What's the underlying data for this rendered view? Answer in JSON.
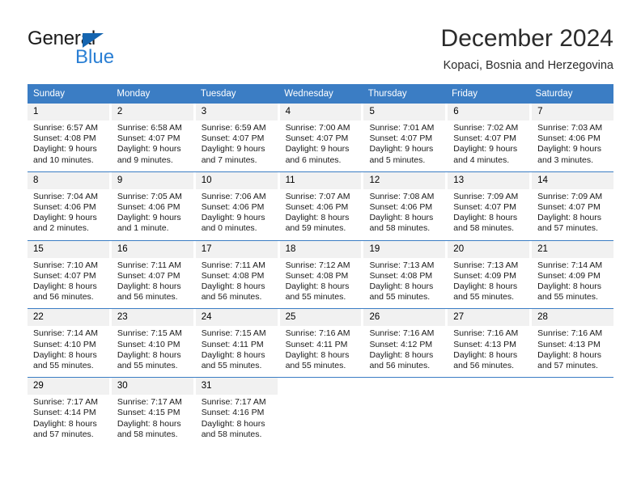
{
  "logo": {
    "word_top": "General",
    "word_bottom": "Blue",
    "triangle_color": "#1565b0",
    "blue_color": "#2a7fd4"
  },
  "header": {
    "title": "December 2024",
    "subtitle": "Kopaci, Bosnia and Herzegovina"
  },
  "calendar": {
    "header_bg": "#3b7dc4",
    "daynum_bg": "#f1f1f1",
    "weekdays": [
      "Sunday",
      "Monday",
      "Tuesday",
      "Wednesday",
      "Thursday",
      "Friday",
      "Saturday"
    ],
    "weeks": [
      [
        {
          "day": "1",
          "sunrise": "Sunrise: 6:57 AM",
          "sunset": "Sunset: 4:08 PM",
          "daylight1": "Daylight: 9 hours",
          "daylight2": "and 10 minutes."
        },
        {
          "day": "2",
          "sunrise": "Sunrise: 6:58 AM",
          "sunset": "Sunset: 4:07 PM",
          "daylight1": "Daylight: 9 hours",
          "daylight2": "and 9 minutes."
        },
        {
          "day": "3",
          "sunrise": "Sunrise: 6:59 AM",
          "sunset": "Sunset: 4:07 PM",
          "daylight1": "Daylight: 9 hours",
          "daylight2": "and 7 minutes."
        },
        {
          "day": "4",
          "sunrise": "Sunrise: 7:00 AM",
          "sunset": "Sunset: 4:07 PM",
          "daylight1": "Daylight: 9 hours",
          "daylight2": "and 6 minutes."
        },
        {
          "day": "5",
          "sunrise": "Sunrise: 7:01 AM",
          "sunset": "Sunset: 4:07 PM",
          "daylight1": "Daylight: 9 hours",
          "daylight2": "and 5 minutes."
        },
        {
          "day": "6",
          "sunrise": "Sunrise: 7:02 AM",
          "sunset": "Sunset: 4:07 PM",
          "daylight1": "Daylight: 9 hours",
          "daylight2": "and 4 minutes."
        },
        {
          "day": "7",
          "sunrise": "Sunrise: 7:03 AM",
          "sunset": "Sunset: 4:06 PM",
          "daylight1": "Daylight: 9 hours",
          "daylight2": "and 3 minutes."
        }
      ],
      [
        {
          "day": "8",
          "sunrise": "Sunrise: 7:04 AM",
          "sunset": "Sunset: 4:06 PM",
          "daylight1": "Daylight: 9 hours",
          "daylight2": "and 2 minutes."
        },
        {
          "day": "9",
          "sunrise": "Sunrise: 7:05 AM",
          "sunset": "Sunset: 4:06 PM",
          "daylight1": "Daylight: 9 hours",
          "daylight2": "and 1 minute."
        },
        {
          "day": "10",
          "sunrise": "Sunrise: 7:06 AM",
          "sunset": "Sunset: 4:06 PM",
          "daylight1": "Daylight: 9 hours",
          "daylight2": "and 0 minutes."
        },
        {
          "day": "11",
          "sunrise": "Sunrise: 7:07 AM",
          "sunset": "Sunset: 4:06 PM",
          "daylight1": "Daylight: 8 hours",
          "daylight2": "and 59 minutes."
        },
        {
          "day": "12",
          "sunrise": "Sunrise: 7:08 AM",
          "sunset": "Sunset: 4:06 PM",
          "daylight1": "Daylight: 8 hours",
          "daylight2": "and 58 minutes."
        },
        {
          "day": "13",
          "sunrise": "Sunrise: 7:09 AM",
          "sunset": "Sunset: 4:07 PM",
          "daylight1": "Daylight: 8 hours",
          "daylight2": "and 58 minutes."
        },
        {
          "day": "14",
          "sunrise": "Sunrise: 7:09 AM",
          "sunset": "Sunset: 4:07 PM",
          "daylight1": "Daylight: 8 hours",
          "daylight2": "and 57 minutes."
        }
      ],
      [
        {
          "day": "15",
          "sunrise": "Sunrise: 7:10 AM",
          "sunset": "Sunset: 4:07 PM",
          "daylight1": "Daylight: 8 hours",
          "daylight2": "and 56 minutes."
        },
        {
          "day": "16",
          "sunrise": "Sunrise: 7:11 AM",
          "sunset": "Sunset: 4:07 PM",
          "daylight1": "Daylight: 8 hours",
          "daylight2": "and 56 minutes."
        },
        {
          "day": "17",
          "sunrise": "Sunrise: 7:11 AM",
          "sunset": "Sunset: 4:08 PM",
          "daylight1": "Daylight: 8 hours",
          "daylight2": "and 56 minutes."
        },
        {
          "day": "18",
          "sunrise": "Sunrise: 7:12 AM",
          "sunset": "Sunset: 4:08 PM",
          "daylight1": "Daylight: 8 hours",
          "daylight2": "and 55 minutes."
        },
        {
          "day": "19",
          "sunrise": "Sunrise: 7:13 AM",
          "sunset": "Sunset: 4:08 PM",
          "daylight1": "Daylight: 8 hours",
          "daylight2": "and 55 minutes."
        },
        {
          "day": "20",
          "sunrise": "Sunrise: 7:13 AM",
          "sunset": "Sunset: 4:09 PM",
          "daylight1": "Daylight: 8 hours",
          "daylight2": "and 55 minutes."
        },
        {
          "day": "21",
          "sunrise": "Sunrise: 7:14 AM",
          "sunset": "Sunset: 4:09 PM",
          "daylight1": "Daylight: 8 hours",
          "daylight2": "and 55 minutes."
        }
      ],
      [
        {
          "day": "22",
          "sunrise": "Sunrise: 7:14 AM",
          "sunset": "Sunset: 4:10 PM",
          "daylight1": "Daylight: 8 hours",
          "daylight2": "and 55 minutes."
        },
        {
          "day": "23",
          "sunrise": "Sunrise: 7:15 AM",
          "sunset": "Sunset: 4:10 PM",
          "daylight1": "Daylight: 8 hours",
          "daylight2": "and 55 minutes."
        },
        {
          "day": "24",
          "sunrise": "Sunrise: 7:15 AM",
          "sunset": "Sunset: 4:11 PM",
          "daylight1": "Daylight: 8 hours",
          "daylight2": "and 55 minutes."
        },
        {
          "day": "25",
          "sunrise": "Sunrise: 7:16 AM",
          "sunset": "Sunset: 4:11 PM",
          "daylight1": "Daylight: 8 hours",
          "daylight2": "and 55 minutes."
        },
        {
          "day": "26",
          "sunrise": "Sunrise: 7:16 AM",
          "sunset": "Sunset: 4:12 PM",
          "daylight1": "Daylight: 8 hours",
          "daylight2": "and 56 minutes."
        },
        {
          "day": "27",
          "sunrise": "Sunrise: 7:16 AM",
          "sunset": "Sunset: 4:13 PM",
          "daylight1": "Daylight: 8 hours",
          "daylight2": "and 56 minutes."
        },
        {
          "day": "28",
          "sunrise": "Sunrise: 7:16 AM",
          "sunset": "Sunset: 4:13 PM",
          "daylight1": "Daylight: 8 hours",
          "daylight2": "and 57 minutes."
        }
      ],
      [
        {
          "day": "29",
          "sunrise": "Sunrise: 7:17 AM",
          "sunset": "Sunset: 4:14 PM",
          "daylight1": "Daylight: 8 hours",
          "daylight2": "and 57 minutes."
        },
        {
          "day": "30",
          "sunrise": "Sunrise: 7:17 AM",
          "sunset": "Sunset: 4:15 PM",
          "daylight1": "Daylight: 8 hours",
          "daylight2": "and 58 minutes."
        },
        {
          "day": "31",
          "sunrise": "Sunrise: 7:17 AM",
          "sunset": "Sunset: 4:16 PM",
          "daylight1": "Daylight: 8 hours",
          "daylight2": "and 58 minutes."
        },
        {
          "day": "",
          "sunrise": "",
          "sunset": "",
          "daylight1": "",
          "daylight2": ""
        },
        {
          "day": "",
          "sunrise": "",
          "sunset": "",
          "daylight1": "",
          "daylight2": ""
        },
        {
          "day": "",
          "sunrise": "",
          "sunset": "",
          "daylight1": "",
          "daylight2": ""
        },
        {
          "day": "",
          "sunrise": "",
          "sunset": "",
          "daylight1": "",
          "daylight2": ""
        }
      ]
    ]
  }
}
